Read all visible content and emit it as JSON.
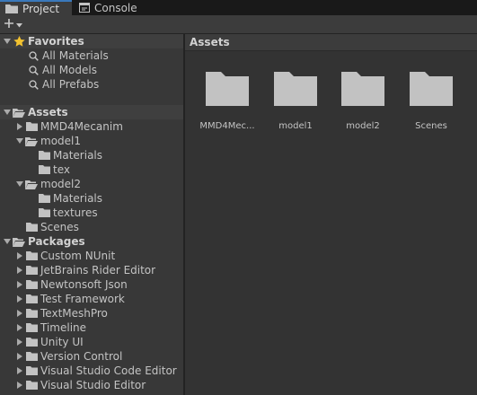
{
  "tabs": [
    {
      "label": "Project",
      "icon": "folder-icon"
    },
    {
      "label": "Console",
      "icon": "console-icon"
    }
  ],
  "toolbar": {
    "create_icon": "plus-icon"
  },
  "favorites": {
    "label": "Favorites",
    "items": [
      "All Materials",
      "All Models",
      "All Prefabs"
    ]
  },
  "assets_tree": {
    "label": "Assets",
    "items": [
      {
        "label": "MMD4Mecanim"
      },
      {
        "label": "model1"
      },
      {
        "label": "Materials"
      },
      {
        "label": "tex"
      },
      {
        "label": "model2"
      },
      {
        "label": "Materials"
      },
      {
        "label": "textures"
      },
      {
        "label": "Scenes"
      }
    ]
  },
  "packages": {
    "label": "Packages",
    "items": [
      "Custom NUnit",
      "JetBrains Rider Editor",
      "Newtonsoft Json",
      "Test Framework",
      "TextMeshPro",
      "Timeline",
      "Unity UI",
      "Version Control",
      "Visual Studio Code Editor",
      "Visual Studio Editor"
    ]
  },
  "content": {
    "header": "Assets",
    "items": [
      "MMD4Mec...",
      "model1",
      "model2",
      "Scenes"
    ]
  },
  "colors": {
    "folder": "#c2c2c2",
    "star": "#f2c230",
    "accent": "#3a79bb"
  }
}
